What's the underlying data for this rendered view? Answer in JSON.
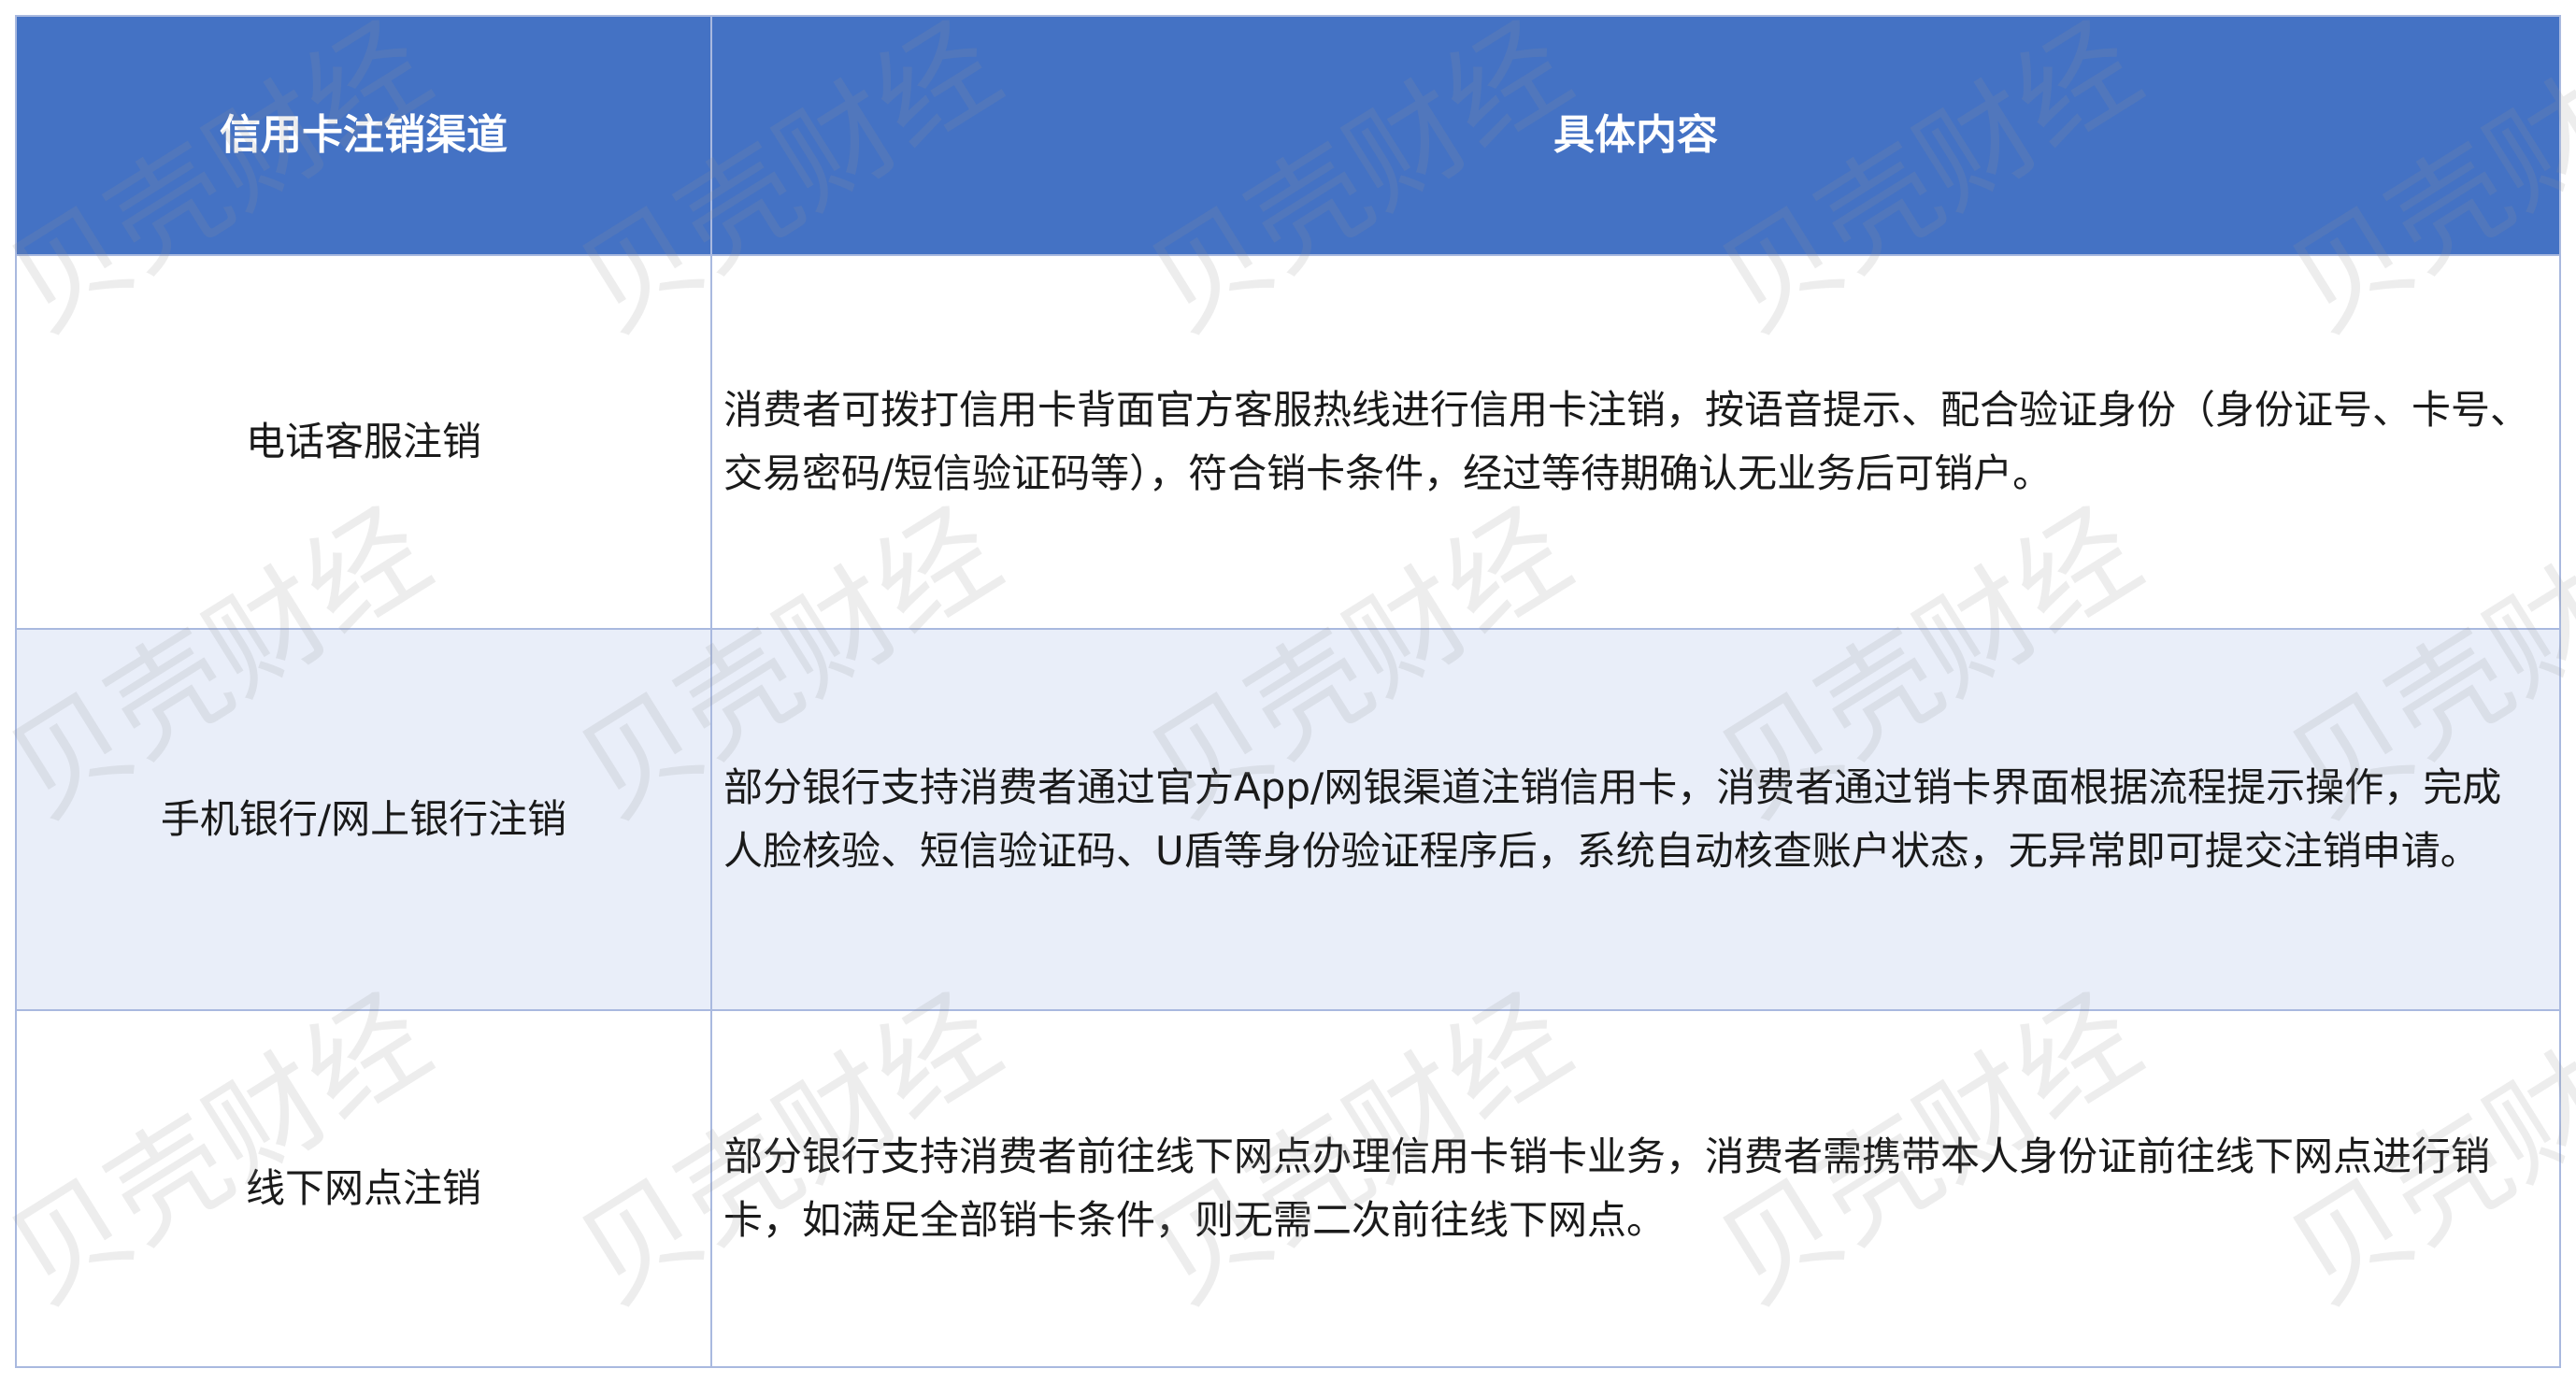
{
  "table": {
    "headers": [
      "信用卡注销渠道",
      "具体内容"
    ],
    "rows": [
      {
        "channel": "电话客服注销",
        "content": "消费者可拨打信用卡背面官方客服热线进行信用卡注销，按语音提示、配合验证身份（身份证号、卡号、交易密码/短信验证码等），符合销卡条件，经过等待期确认无业务后可销户。"
      },
      {
        "channel": "手机银行/网上银行注销",
        "content": "部分银行支持消费者通过官方App/网银渠道注销信用卡，消费者通过销卡界面根据流程提示操作，完成人脸核验、短信验证码、U盾等身份验证程序后，系统自动核查账户状态，无异常即可提交注销申请。"
      },
      {
        "channel": "线下网点注销",
        "content": "部分银行支持消费者前往线下网点办理信用卡销卡业务，消费者需携带本人身份证前往线下网点进行销卡，如满足全部销卡条件，则无需二次前往线下网点。"
      }
    ]
  },
  "watermark": "贝壳财经",
  "colors": {
    "header_bg": "#4472c4",
    "header_text": "#ffffff",
    "alt_row_bg": "#e9eef9",
    "border": "#a9b9df"
  }
}
